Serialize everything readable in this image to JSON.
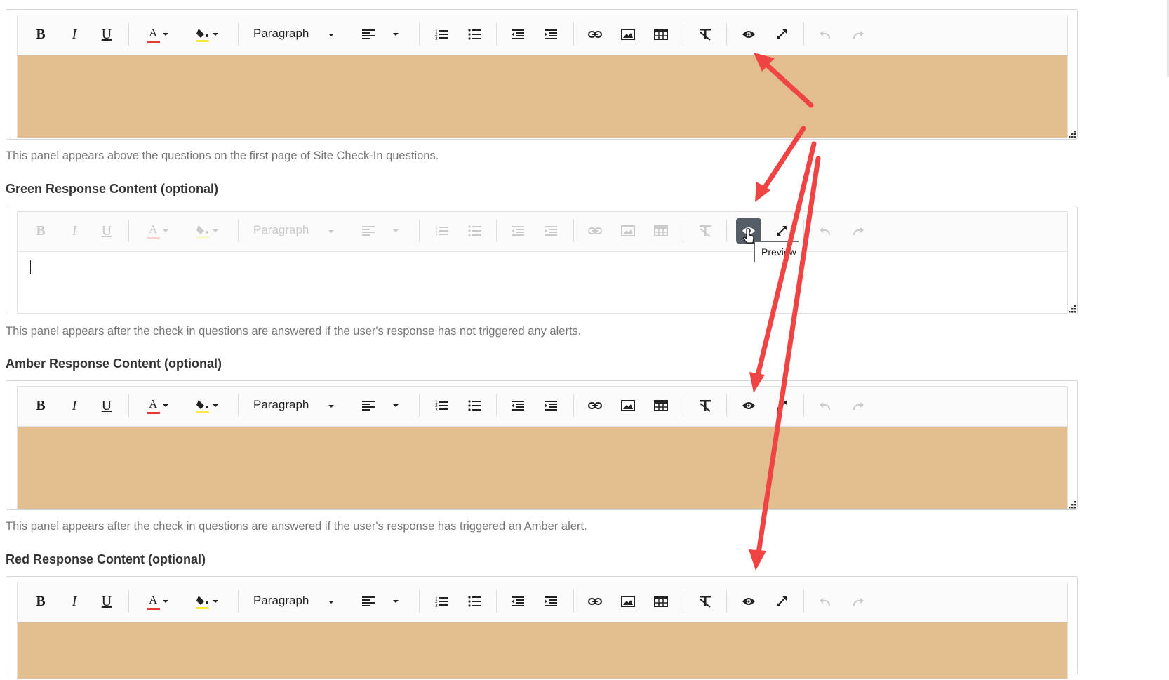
{
  "toolbar": {
    "bold": "B",
    "italic": "I",
    "underline": "U",
    "text_color": "A",
    "paragraph": "Paragraph"
  },
  "editors": [
    {
      "state": "enabled",
      "content": "tan"
    },
    {
      "state": "disabled",
      "content": "white"
    },
    {
      "state": "enabled",
      "content": "tan"
    },
    {
      "state": "enabled",
      "content": "tan"
    }
  ],
  "help_texts": [
    "This panel appears above the questions on the first page of Site Check-In questions.",
    "This panel appears after the check in questions are answered if the user's response has not triggered any alerts.",
    "This panel appears after the check in questions are answered if the user's response has triggered an Amber alert."
  ],
  "labels": {
    "green": "Green Response Content (optional)",
    "amber": "Amber Response Content (optional)",
    "red": "Red Response Content (optional)"
  },
  "tooltip": "Preview",
  "colors": {
    "content_fill": "#e2bd8e",
    "annotation_arrow": "#f04444",
    "active_button": "#555d66",
    "text_color_underline": "#e53935",
    "highlight_underline": "#ffeb3b"
  }
}
